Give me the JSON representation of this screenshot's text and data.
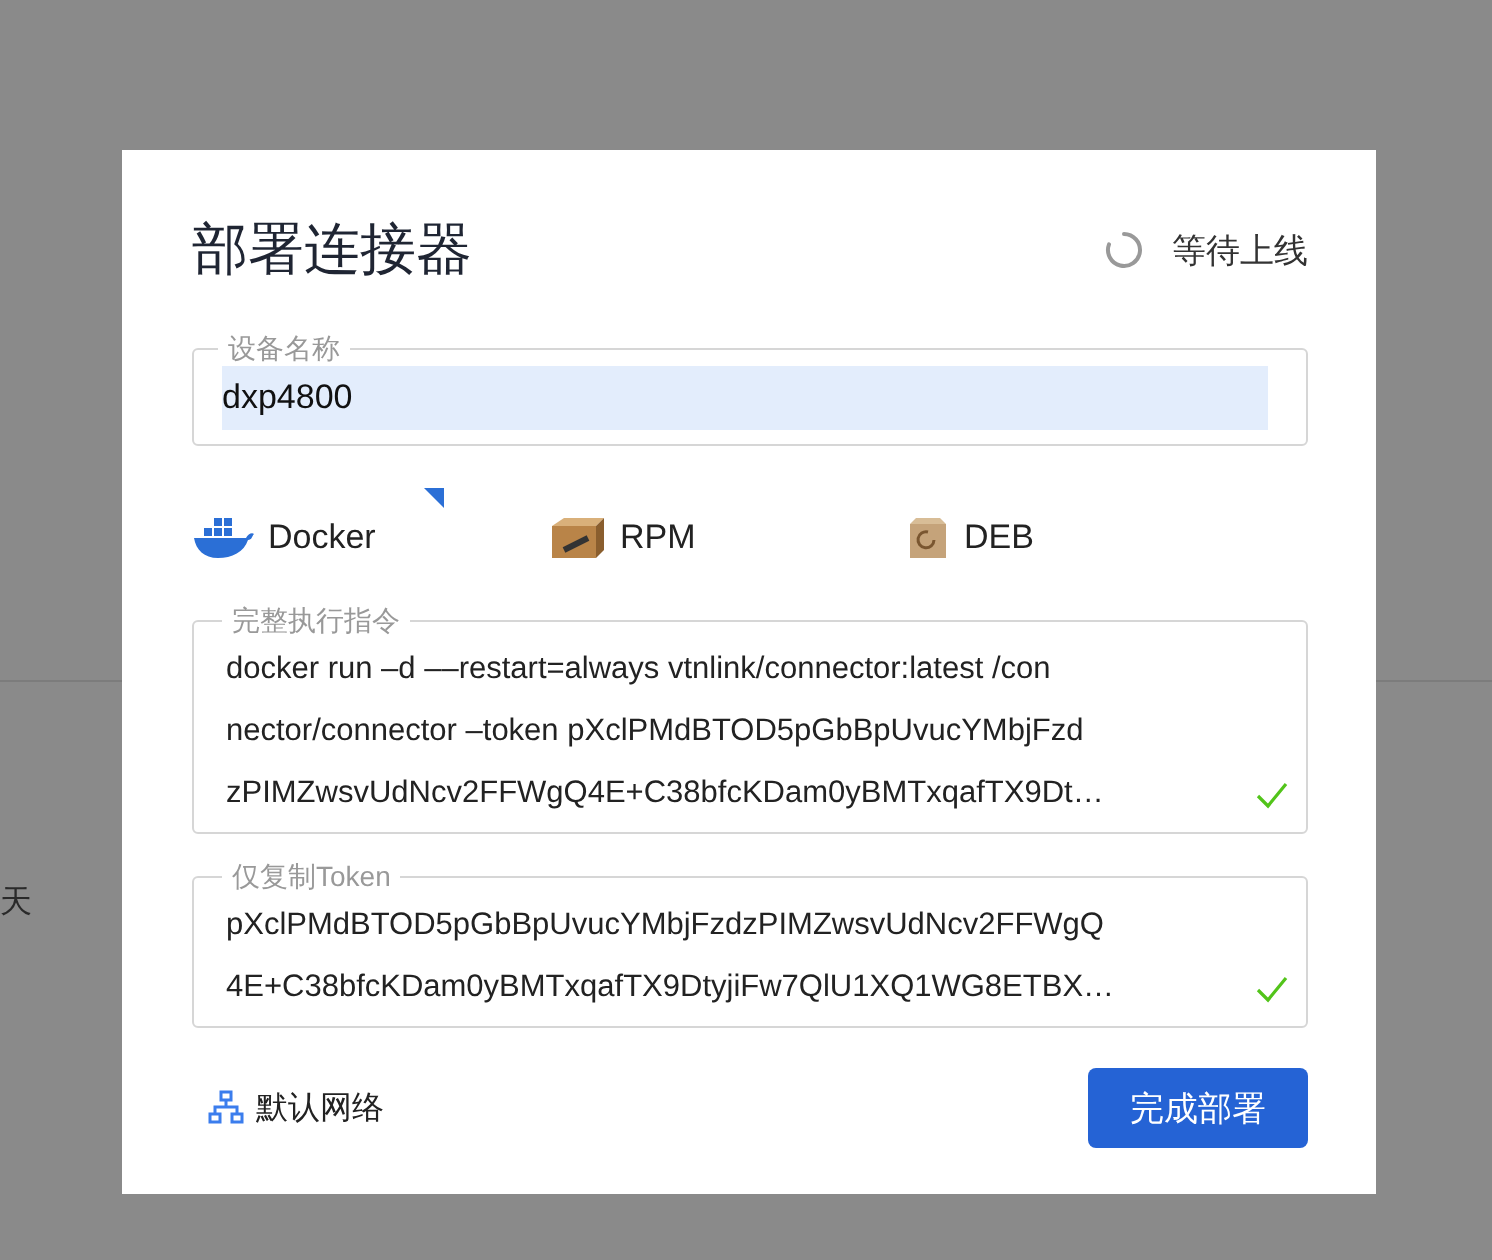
{
  "background": {
    "text": "天"
  },
  "dialog": {
    "title": "部署连接器",
    "status": "等待上线",
    "device_name": {
      "label": "设备名称",
      "value": "dxp4800",
      "highlighted": true
    },
    "packages": [
      {
        "kind": "docker",
        "label": "Docker",
        "selected": true
      },
      {
        "kind": "rpm",
        "label": "RPM",
        "selected": false
      },
      {
        "kind": "deb",
        "label": "DEB",
        "selected": false
      }
    ],
    "fields": [
      {
        "label": "完整执行指令",
        "lines": [
          "docker run –d ––restart=always vtnlink/connector:latest /con",
          "nector/connector –token pXclPMdBTOD5pGbBpUvucYMbjFzd",
          "zPIMZwsvUdNcv2FFWgQ4E+C38bfcKDam0yBMTxqafTX9Dt…"
        ],
        "copied": true
      },
      {
        "label": "仅复制Token",
        "lines": [
          "pXclPMdBTOD5pGbBpUvucYMbjFzdzPIMZwsvUdNcv2FFWgQ",
          "4E+C38bfcKDam0yBMTxqafTX9DtyjiFw7QlU1XQ1WG8ETBX…"
        ],
        "copied": true
      }
    ],
    "network": "默认网络",
    "finish_button": "完成部署"
  }
}
